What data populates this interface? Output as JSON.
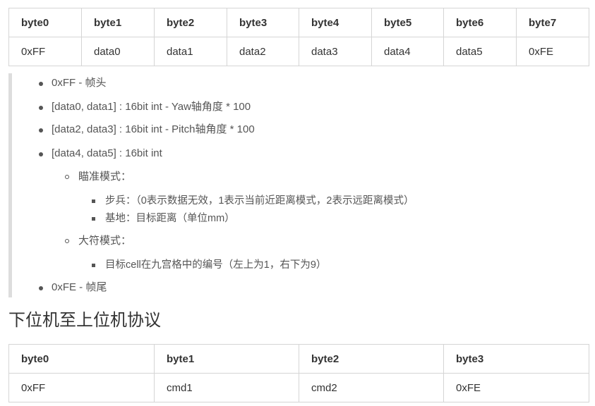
{
  "table_upper": {
    "headers": [
      "byte0",
      "byte1",
      "byte2",
      "byte3",
      "byte4",
      "byte5",
      "byte6",
      "byte7"
    ],
    "row": [
      "0xFF",
      "data0",
      "data1",
      "data2",
      "data3",
      "data4",
      "data5",
      "0xFE"
    ]
  },
  "list": {
    "item0": "0xFF - 帧头",
    "item1": "[data0, data1] : 16bit int - Yaw轴角度 * 100",
    "item2": "[data2, data3] : 16bit int - Pitch轴角度 * 100",
    "item3": "[data4, data5] : 16bit int",
    "aim_mode": "瞄准模式：",
    "infantry": "步兵：（0表示数据无效，1表示当前近距离模式，2表示远距离模式）",
    "base": "基地：目标距离（单位mm）",
    "rune_mode": "大符模式：",
    "rune_cell": "目标cell在九宫格中的编号（左上为1，右下为9）",
    "item4": "0xFE - 帧尾"
  },
  "heading": "下位机至上位机协议",
  "table_lower": {
    "headers": [
      "byte0",
      "byte1",
      "byte2",
      "byte3"
    ],
    "row": [
      "0xFF",
      "cmd1",
      "cmd2",
      "0xFE"
    ]
  }
}
